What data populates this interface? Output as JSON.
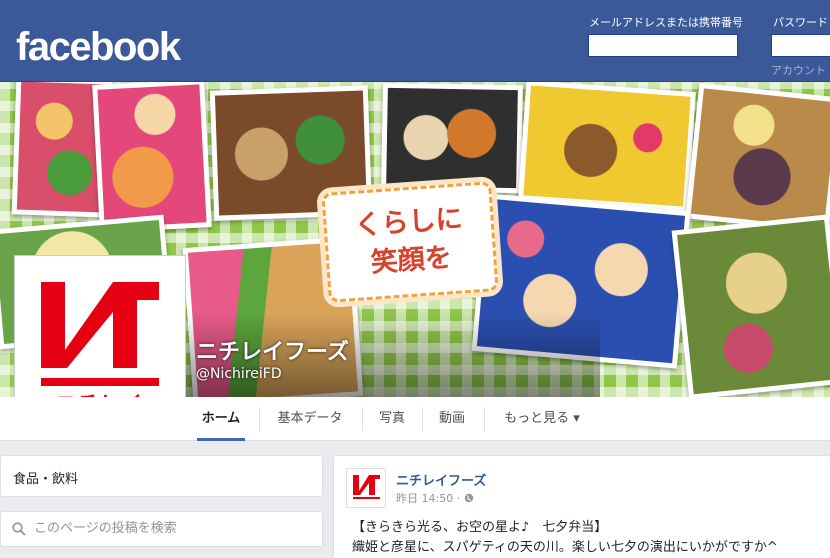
{
  "header": {
    "logo": "facebook",
    "email_label": "メールアドレスまたは携帯番号",
    "password_label": "パスワード",
    "forgot_link": "アカウント"
  },
  "page": {
    "name": "ニチレイフーズ",
    "handle": "@NichireiFD",
    "cover_slogan_line1": "くらしに",
    "cover_slogan_line2": "笑顔を",
    "logo_text": "ニチレイ",
    "brand_color": "#e50012"
  },
  "nav": {
    "tabs": [
      {
        "label": "ホーム",
        "active": true
      },
      {
        "label": "基本データ"
      },
      {
        "label": "写真"
      },
      {
        "label": "動画"
      },
      {
        "label": "もっと見る ▾"
      }
    ]
  },
  "sidebar": {
    "category": "食品・飲料",
    "search_placeholder": "このページの投稿を検索",
    "search_icon": "search-icon"
  },
  "post": {
    "author": "ニチレイフーズ",
    "time": "昨日 14:50",
    "privacy_icon": "globe-icon",
    "line1": "【きらきら光る、お空の星よ♪　七夕弁当】",
    "line2": "織姫と彦星に、スパゲティの天の川。楽しい七夕の演出にいかがですか^"
  }
}
